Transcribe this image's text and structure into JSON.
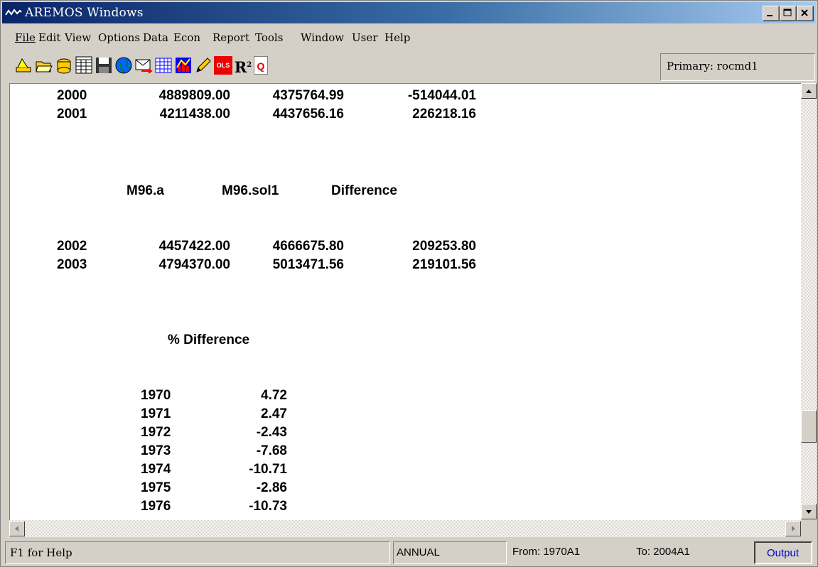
{
  "window": {
    "title": "AREMOS Windows"
  },
  "menu": [
    "File",
    "Edit",
    "View",
    "Options",
    "Data",
    "Econ",
    "Report",
    "Tools",
    "Window",
    "User",
    "Help"
  ],
  "toolbar": {
    "icons": [
      "wizard-icon",
      "open-folder-icon",
      "open-databank-icon",
      "series-icon",
      "save-icon",
      "globe-icon",
      "mail-icon",
      "table-icon",
      "chart-icon",
      "pencil-icon",
      "ols-icon",
      "r-squared-icon",
      "q-icon"
    ],
    "ols_label": "OLS",
    "r2_label": "R",
    "r2_sup": "2",
    "q_label": "Q",
    "primary_label": "Primary: rocmd1"
  },
  "output": {
    "top_rows": [
      [
        "2000",
        "4889809.00",
        "4375764.99",
        "-514044.01"
      ],
      [
        "2001",
        "4211438.00",
        "4437656.16",
        "226218.16"
      ]
    ],
    "headers": [
      "M96.a",
      "M96.sol1",
      "Difference"
    ],
    "mid_rows": [
      [
        "2002",
        "4457422.00",
        "4666675.80",
        "209253.80"
      ],
      [
        "2003",
        "4794370.00",
        "5013471.56",
        "219101.56"
      ]
    ],
    "pct_header": "% Difference",
    "pct_rows": [
      [
        "1970",
        "4.72"
      ],
      [
        "1971",
        "2.47"
      ],
      [
        "1972",
        "-2.43"
      ],
      [
        "1973",
        "-7.68"
      ],
      [
        "1974",
        "-10.71"
      ],
      [
        "1975",
        "-2.86"
      ],
      [
        "1976",
        "-10.73"
      ]
    ]
  },
  "statusbar": {
    "help": "F1 for Help",
    "freq": "ANNUAL",
    "from": "From: 1970A1",
    "to": "To: 2004A1",
    "mode": "Output"
  },
  "colors": {
    "title_start": "#0a246a",
    "title_end": "#a6caf0",
    "output_text": "#0000cc"
  }
}
